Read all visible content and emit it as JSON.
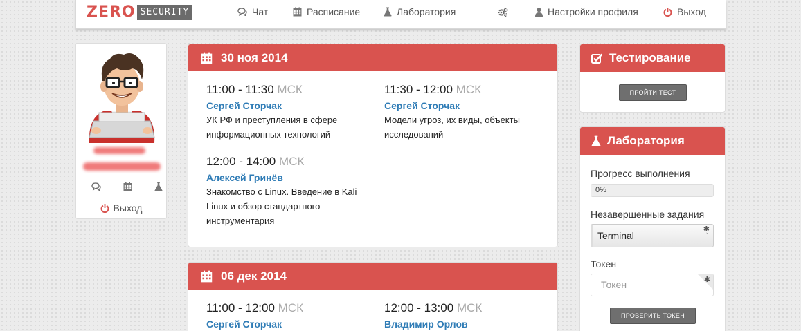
{
  "navbar": {
    "logo_zero": "ZERO",
    "logo_security": "SECURITY",
    "chat": "Чат",
    "schedule": "Расписание",
    "lab": "Лаборатория",
    "profile_settings": "Настройки профиля",
    "logout": "Выход"
  },
  "profile": {
    "logout": "Выход"
  },
  "days": [
    {
      "date": "30 ноя 2014",
      "slots": [
        {
          "time": "11:00 - 11:30",
          "tz": "МСК",
          "speaker": "Сергей Сторчак",
          "topic": "УК РФ и преступления в сфере информационных технологий"
        },
        {
          "time": "11:30 - 12:00",
          "tz": "МСК",
          "speaker": "Сергей Сторчак",
          "topic": "Модели угроз, их виды, объекты исследований"
        },
        {
          "time": "12:00 - 14:00",
          "tz": "МСК",
          "speaker": "Алексей Гринёв",
          "topic": "Знакомство с Linux. Введение в Kali Linux и обзор стандартного инструментария"
        }
      ]
    },
    {
      "date": "06 дек 2014",
      "slots": [
        {
          "time": "11:00 - 12:00",
          "tz": "МСК",
          "speaker": "Сергей Сторчак",
          "topic": ""
        },
        {
          "time": "12:00 - 13:00",
          "tz": "МСК",
          "speaker": "Владимир Орлов",
          "topic": ""
        }
      ]
    }
  ],
  "testing": {
    "title": "Тестирование",
    "button": "ПРОЙТИ ТЕСТ"
  },
  "laboratory": {
    "title": "Лаборатория",
    "progress_label": "Прогресс выполнения",
    "progress_value": "0%",
    "progress_fraction": 0,
    "tasks_label": "Незавершенные задания",
    "tasks_selected": "Terminal",
    "token_label": "Токен",
    "token_placeholder": "Токен",
    "check_button": "ПРОВЕРИТЬ ТОКЕН"
  },
  "colors": {
    "accent": "#d9534f",
    "link": "#2f7cb6",
    "button": "#6f6f6f"
  }
}
